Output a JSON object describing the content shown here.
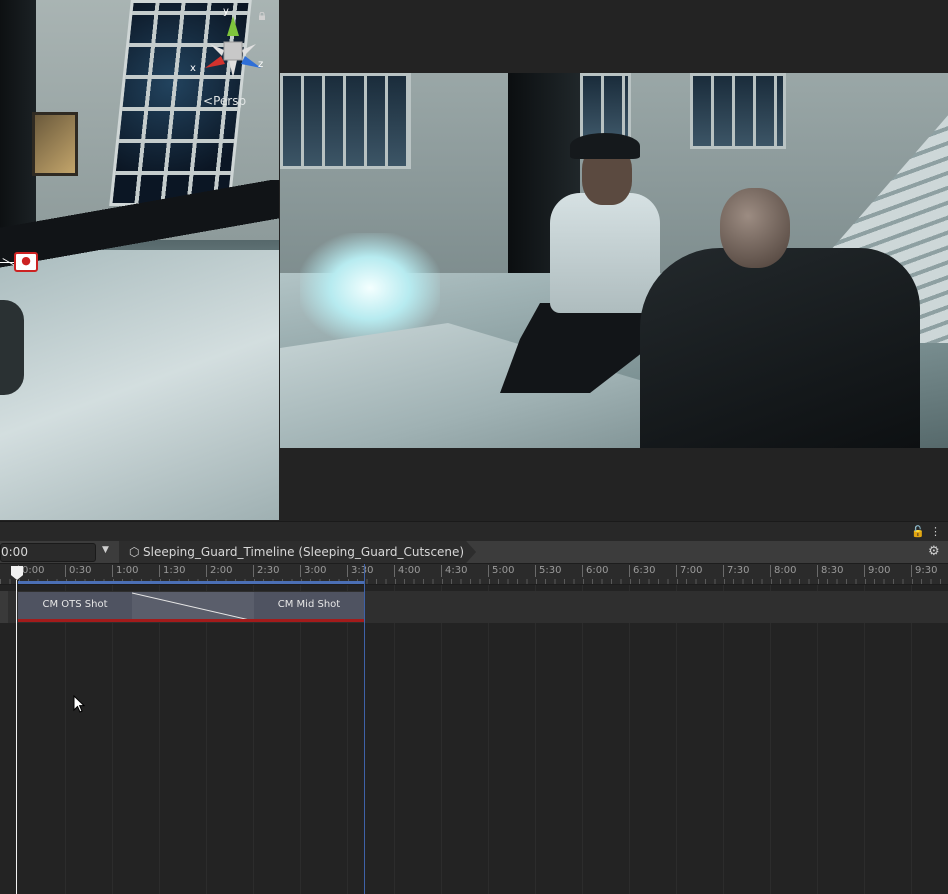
{
  "scene_view": {
    "projection_label": "Persp",
    "axis_labels": {
      "x": "x",
      "y": "y",
      "z": "z"
    }
  },
  "timeline": {
    "current_time": "0:00",
    "breadcrumb": "Sleeping_Guard_Timeline (Sleeping_Guard_Cutscene)",
    "ruler_ticks": [
      "0:00",
      "0:30",
      "1:00",
      "1:30",
      "2:00",
      "2:30",
      "3:00",
      "3:30",
      "4:00",
      "4:30",
      "5:00",
      "5:30",
      "6:00",
      "6:30",
      "7:00",
      "7:30",
      "8:00",
      "8:30",
      "9:00",
      "9:30"
    ],
    "clips": [
      {
        "label": "CM OTS Shot"
      },
      {
        "label": "CM Mid Shot"
      }
    ]
  },
  "colors": {
    "clip_fill": "#4f5361",
    "clip_underline": "#a31b1b",
    "play_range": "#4b6fb4",
    "playhead": "#f2f2f2"
  }
}
